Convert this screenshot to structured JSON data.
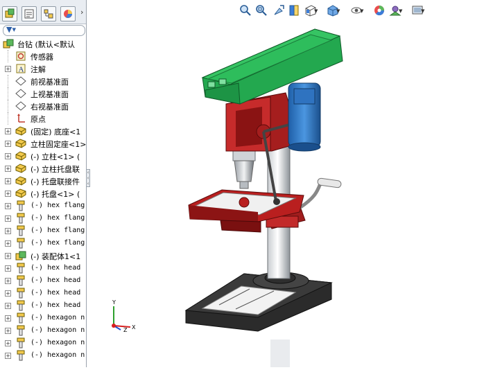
{
  "tree": {
    "root_label": "台钻  (默认<默认",
    "items": [
      {
        "label": "传感器",
        "icon": "sensor-icon",
        "expandable": false
      },
      {
        "label": "注解",
        "icon": "annotation-icon",
        "expandable": true
      },
      {
        "label": "前视基准面",
        "icon": "plane-icon",
        "expandable": false
      },
      {
        "label": "上视基准面",
        "icon": "plane-icon",
        "expandable": false
      },
      {
        "label": "右视基准面",
        "icon": "plane-icon",
        "expandable": false
      },
      {
        "label": "原点",
        "icon": "origin-icon",
        "expandable": false
      },
      {
        "label": "(固定) 底座<1",
        "icon": "part-icon",
        "expandable": true
      },
      {
        "label": "立柱固定座<1>",
        "icon": "part-icon",
        "expandable": true
      },
      {
        "label": "(-) 立柱<1> (",
        "icon": "part-icon",
        "expandable": true
      },
      {
        "label": "(-) 立柱托盘联",
        "icon": "part-icon",
        "expandable": true
      },
      {
        "label": "(-) 托盘联接件",
        "icon": "part-icon",
        "expandable": true
      },
      {
        "label": "(-) 托盘<1> (",
        "icon": "part-icon",
        "expandable": true
      },
      {
        "label": "(-) hex flang",
        "icon": "fastener-icon",
        "expandable": true
      },
      {
        "label": "(-) hex flang",
        "icon": "fastener-icon",
        "expandable": true
      },
      {
        "label": "(-) hex flang",
        "icon": "fastener-icon",
        "expandable": true
      },
      {
        "label": "(-) hex flang",
        "icon": "fastener-icon",
        "expandable": true
      },
      {
        "label": "(-) 装配体1<1",
        "icon": "subassembly-icon",
        "expandable": true
      },
      {
        "label": "(-) hex head",
        "icon": "fastener-icon",
        "expandable": true
      },
      {
        "label": "(-) hex head",
        "icon": "fastener-icon",
        "expandable": true
      },
      {
        "label": "(-) hex head",
        "icon": "fastener-icon",
        "expandable": true
      },
      {
        "label": "(-) hex head",
        "icon": "fastener-icon",
        "expandable": true
      },
      {
        "label": "(-) hexagon n",
        "icon": "fastener-icon",
        "expandable": true
      },
      {
        "label": "(-) hexagon n",
        "icon": "fastener-icon",
        "expandable": true
      },
      {
        "label": "(-) hexagon n",
        "icon": "fastener-icon",
        "expandable": true
      },
      {
        "label": "(-) hexagon n",
        "icon": "fastener-icon",
        "expandable": true
      }
    ]
  },
  "tabs": [
    "feature-manager-tab",
    "property-manager-tab",
    "configuration-manager-tab",
    "display-manager-tab"
  ],
  "toolbar": [
    "zoom-to-fit-icon",
    "zoom-to-area-icon",
    "previous-view-icon",
    "section-view-icon",
    "view-orientation-icon",
    "display-style-icon",
    "hide-show-items-icon",
    "edit-appearance-icon",
    "apply-scene-icon",
    "view-settings-icon"
  ],
  "triad": {
    "x": "X",
    "y": "Y",
    "z": "Z"
  }
}
